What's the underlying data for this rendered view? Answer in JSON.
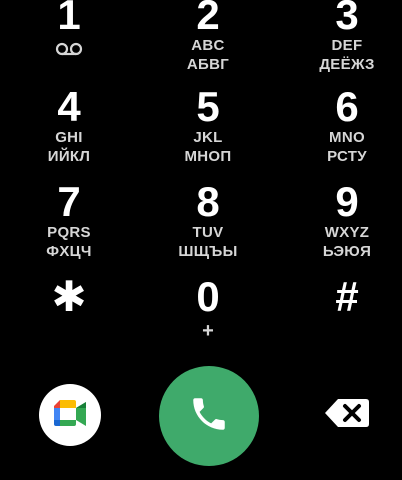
{
  "dialpad": {
    "keys": [
      {
        "digit": "1",
        "sub1": "",
        "sub2": "",
        "icon": "voicemail-icon"
      },
      {
        "digit": "2",
        "sub1": "ABC",
        "sub2": "АБВГ"
      },
      {
        "digit": "3",
        "sub1": "DEF",
        "sub2": "ДЕЁЖЗ"
      },
      {
        "digit": "4",
        "sub1": "GHI",
        "sub2": "ИЙКЛ"
      },
      {
        "digit": "5",
        "sub1": "JKL",
        "sub2": "МНОП"
      },
      {
        "digit": "6",
        "sub1": "MNO",
        "sub2": "РСТУ"
      },
      {
        "digit": "7",
        "sub1": "PQRS",
        "sub2": "ФХЦЧ"
      },
      {
        "digit": "8",
        "sub1": "TUV",
        "sub2": "ШЩЪЫ"
      },
      {
        "digit": "9",
        "sub1": "WXYZ",
        "sub2": "ЬЭЮЯ"
      },
      {
        "digit": "✱",
        "sub1": "",
        "sub2": ""
      },
      {
        "digit": "0",
        "sub1": "+",
        "sub2": ""
      },
      {
        "digit": "#",
        "sub1": "",
        "sub2": ""
      }
    ]
  },
  "actions": {
    "meet_icon": "google-meet-icon",
    "call_icon": "phone-icon",
    "backspace_icon": "backspace-icon"
  },
  "colors": {
    "background": "#000000",
    "call_button": "#3faa6b",
    "text": "#ffffff"
  }
}
